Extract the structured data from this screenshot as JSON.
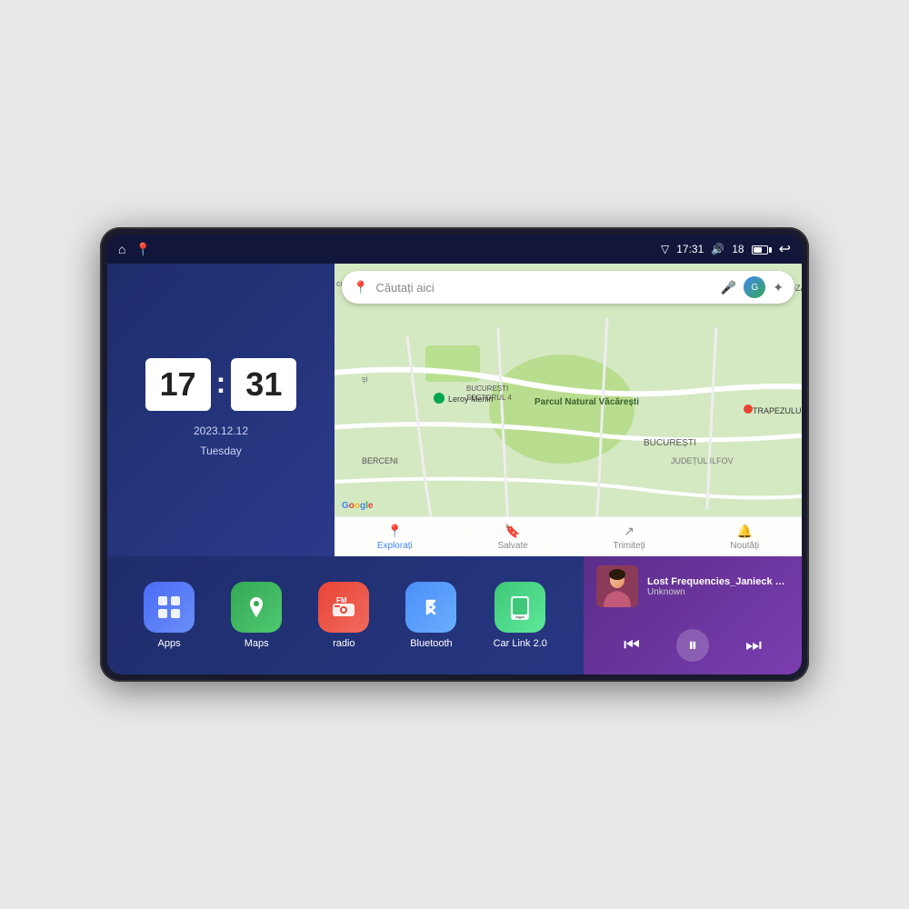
{
  "device": {
    "status_bar": {
      "left_icons": [
        "home",
        "maps-pin"
      ],
      "time": "17:31",
      "signal_icon": "signal",
      "volume_icon": "volume",
      "volume_level": "18",
      "battery_icon": "battery",
      "back_icon": "back"
    },
    "clock": {
      "hours": "17",
      "minutes": "31",
      "date": "2023.12.12",
      "day": "Tuesday"
    },
    "map": {
      "search_placeholder": "Căutați aici",
      "nav_items": [
        {
          "label": "Explorați",
          "active": true
        },
        {
          "label": "Salvate",
          "active": false
        },
        {
          "label": "Trimiteți",
          "active": false
        },
        {
          "label": "Noutăți",
          "active": false
        }
      ]
    },
    "apps": [
      {
        "id": "apps",
        "label": "Apps",
        "icon_class": "icon-apps",
        "icon": "⊞"
      },
      {
        "id": "maps",
        "label": "Maps",
        "icon_class": "icon-maps",
        "icon": "📍"
      },
      {
        "id": "radio",
        "label": "radio",
        "icon_class": "icon-radio",
        "icon": "📻"
      },
      {
        "id": "bluetooth",
        "label": "Bluetooth",
        "icon_class": "icon-bluetooth",
        "icon": "⚡"
      },
      {
        "id": "carlink",
        "label": "Car Link 2.0",
        "icon_class": "icon-carlink",
        "icon": "📱"
      }
    ],
    "music": {
      "title": "Lost Frequencies_Janieck Devy-...",
      "artist": "Unknown",
      "controls": {
        "prev": "⏮",
        "play": "⏸",
        "next": "⏭"
      }
    }
  }
}
